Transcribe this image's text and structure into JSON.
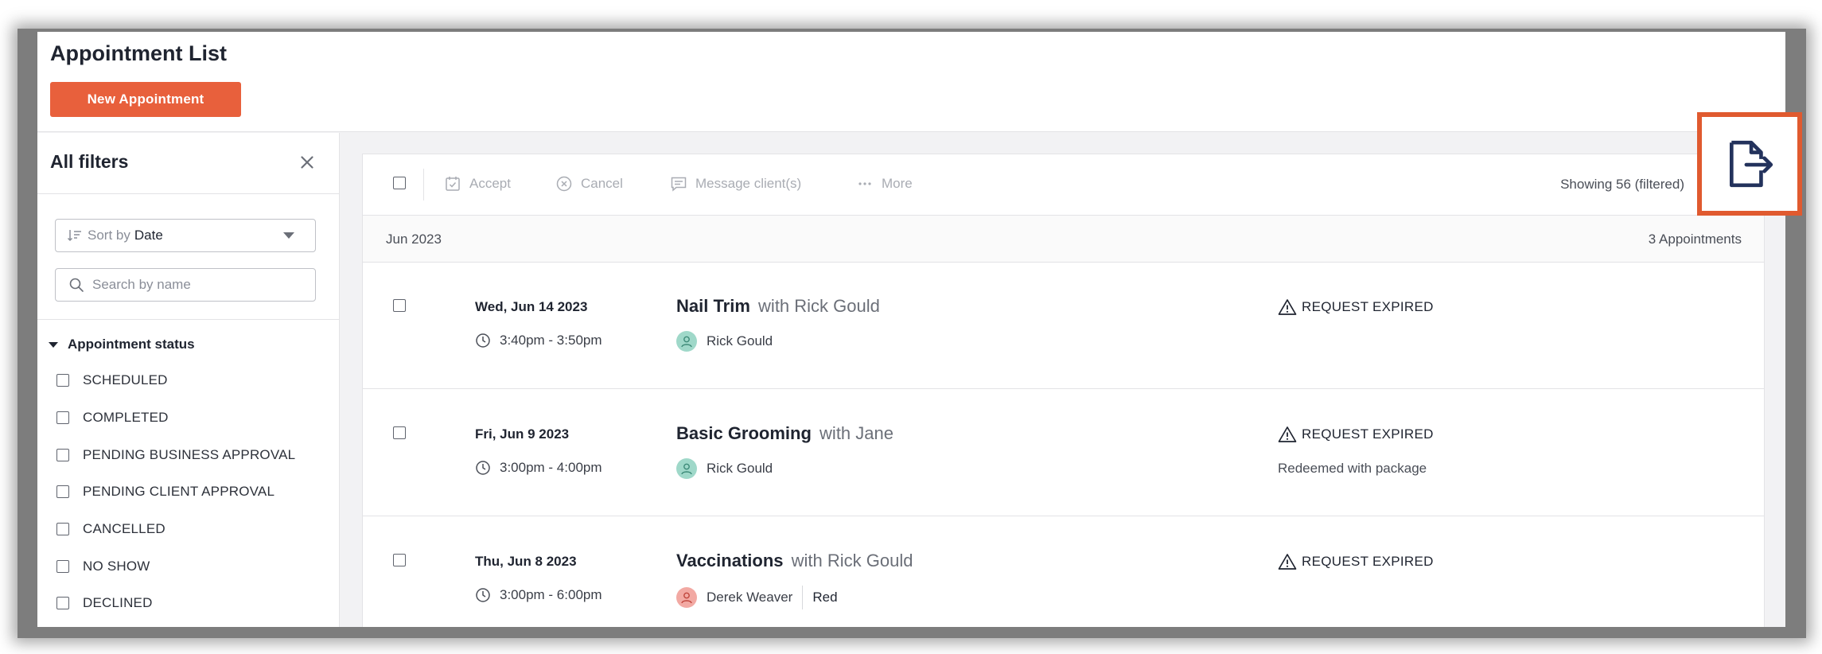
{
  "header": {
    "title": "Appointment List",
    "new_button": "New Appointment"
  },
  "sidebar": {
    "title": "All filters",
    "sort": {
      "prefix": "Sort by",
      "value": "Date"
    },
    "search": {
      "placeholder": "Search by name",
      "value": ""
    },
    "status_group": {
      "label": "Appointment status",
      "options": [
        "SCHEDULED",
        "COMPLETED",
        "PENDING BUSINESS APPROVAL",
        "PENDING CLIENT APPROVAL",
        "CANCELLED",
        "NO SHOW",
        "DECLINED"
      ]
    }
  },
  "toolbar": {
    "accept": "Accept",
    "cancel": "Cancel",
    "message": "Message client(s)",
    "more": "More",
    "showing": "Showing 56 (filtered)"
  },
  "group": {
    "month": "Jun 2023",
    "count": "3 Appointments"
  },
  "appointments": [
    {
      "date": "Wed, Jun 14 2023",
      "time": "3:40pm - 3:50pm",
      "service": "Nail Trim",
      "with": "with Rick Gould",
      "client": "Rick Gould",
      "pet": "",
      "status": "REQUEST EXPIRED",
      "note": ""
    },
    {
      "date": "Fri, Jun 9 2023",
      "time": "3:00pm - 4:00pm",
      "service": "Basic Grooming",
      "with": "with Jane",
      "client": "Rick Gould",
      "pet": "",
      "status": "REQUEST EXPIRED",
      "note": "Redeemed with package"
    },
    {
      "date": "Thu, Jun 8 2023",
      "time": "3:00pm - 6:00pm",
      "service": "Vaccinations",
      "with": "with Rick Gould",
      "client": "Derek Weaver",
      "pet": "Red",
      "status": "REQUEST EXPIRED",
      "note": ""
    }
  ],
  "colors": {
    "accent": "#e8603c",
    "highlight_border": "#e05a2f",
    "avatar_green": "#9fd8c9",
    "avatar_red": "#f2a9a3"
  },
  "icons": {
    "export": "export-file-icon",
    "close": "close-icon",
    "search": "search-icon"
  }
}
